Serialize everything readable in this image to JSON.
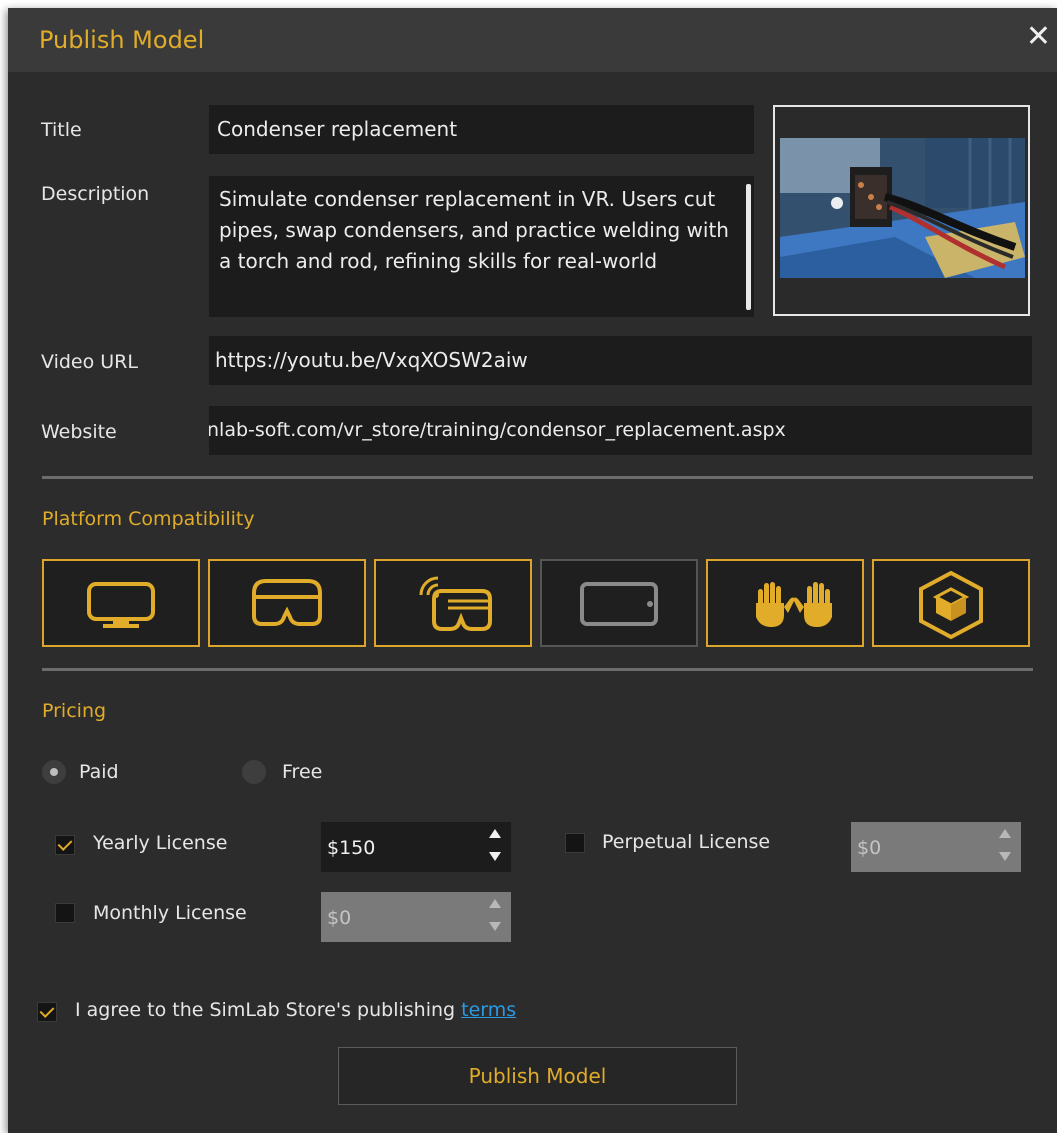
{
  "dialog": {
    "title": "Publish Model",
    "close_icon": "close-icon",
    "accent_color": "#e0ac2a"
  },
  "form": {
    "title_label": "Title",
    "title_value": "Condenser replacement",
    "description_label": "Description",
    "description_value": "Simulate condenser replacement in VR. Users cut pipes, swap condensers, and practice welding with a torch and rod, refining skills for real-world",
    "video_url_label": "Video URL",
    "video_url_value": "https://youtu.be/VxqXOSW2aiw",
    "website_label": "Website",
    "website_value": "nlab-soft.com/vr_store/training/condensor_replacement.aspx"
  },
  "platform": {
    "heading": "Platform Compatibility",
    "items": [
      {
        "icon": "desktop-monitor-icon",
        "enabled": true
      },
      {
        "icon": "vr-headset-icon",
        "enabled": true
      },
      {
        "icon": "wireless-vr-headset-icon",
        "enabled": true
      },
      {
        "icon": "tablet-icon",
        "enabled": false
      },
      {
        "icon": "hand-tracking-icon",
        "enabled": true
      },
      {
        "icon": "ar-cube-icon",
        "enabled": true
      }
    ]
  },
  "pricing": {
    "heading": "Pricing",
    "paid_label": "Paid",
    "free_label": "Free",
    "selected": "Paid",
    "yearly_label": "Yearly License",
    "yearly_checked": true,
    "yearly_value": "$150",
    "perpetual_label": "Perpetual License",
    "perpetual_checked": false,
    "perpetual_value": "$0",
    "monthly_label": "Monthly License",
    "monthly_checked": false,
    "monthly_value": "$0"
  },
  "agreement": {
    "text": "I agree to the SimLab Store's publishing ",
    "link": "terms",
    "checked": true
  },
  "publish_button": "Publish Model"
}
